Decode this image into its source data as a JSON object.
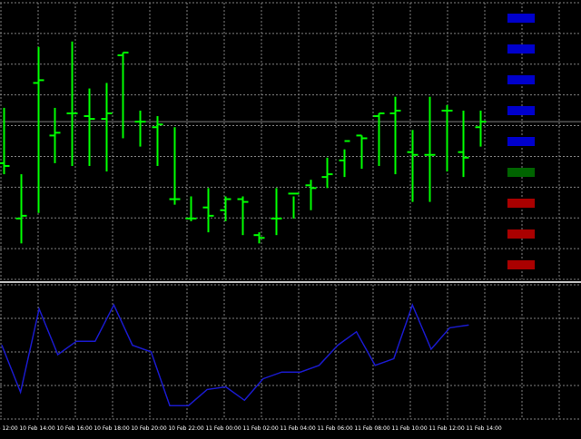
{
  "colors": {
    "background": "#000000",
    "grid": "#808080",
    "bars": "#00ff00",
    "indicator": "#1a1acc",
    "separator": "#c0c0c0",
    "level_blue": "#0000cc",
    "level_green": "#006400",
    "level_red": "#aa0000"
  },
  "chart_data": [
    {
      "type": "ohlc",
      "panel": "price",
      "grid": true,
      "y_range": [
        0,
        100
      ],
      "x_tick_labels": [
        "10 Feb 12:00",
        "10 Feb 14:00",
        "10 Feb 16:00",
        "10 Feb 18:00",
        "10 Feb 20:00",
        "10 Feb 22:00",
        "11 Feb 00:00",
        "11 Feb 02:00",
        "11 Feb 04:00",
        "11 Feb 06:00",
        "11 Feb 08:00",
        "11 Feb 10:00",
        "11 Feb 12:00",
        "11 Feb 14:00"
      ],
      "bars": [
        {
          "o": 42,
          "h": 62,
          "l": 38,
          "c": 41
        },
        {
          "o": 22,
          "h": 38,
          "l": 13,
          "c": 23
        },
        {
          "o": 71,
          "h": 84,
          "l": 24,
          "c": 72
        },
        {
          "o": 52,
          "h": 62,
          "l": 42,
          "c": 53
        },
        {
          "o": 60,
          "h": 86,
          "l": 41,
          "c": 60
        },
        {
          "o": 59,
          "h": 69,
          "l": 41,
          "c": 58
        },
        {
          "o": 58,
          "h": 71,
          "l": 39,
          "c": 60
        },
        {
          "o": 81,
          "h": 82,
          "l": 51,
          "c": 82
        },
        {
          "o": 57,
          "h": 61,
          "l": 48,
          "c": 57
        },
        {
          "o": 55,
          "h": 59,
          "l": 41,
          "c": 56
        },
        {
          "o": 29,
          "h": 55,
          "l": 27,
          "c": 29
        },
        {
          "o": 22,
          "h": 30,
          "l": 21,
          "c": 22
        },
        {
          "o": 26,
          "h": 33,
          "l": 17,
          "c": 23
        },
        {
          "o": 25,
          "h": 30,
          "l": 21,
          "c": 29
        },
        {
          "o": 29,
          "h": 30,
          "l": 16,
          "c": 28
        },
        {
          "o": 16,
          "h": 17,
          "l": 13,
          "c": 15
        },
        {
          "o": 22,
          "h": 33,
          "l": 16,
          "c": 22
        },
        {
          "o": 31,
          "h": 30,
          "l": 22,
          "c": 31
        },
        {
          "o": 34,
          "h": 36,
          "l": 25,
          "c": 33
        },
        {
          "o": 37,
          "h": 44,
          "l": 33,
          "c": 38
        },
        {
          "o": 43,
          "h": 47,
          "l": 37,
          "c": 50
        },
        {
          "o": 52,
          "h": 52,
          "l": 40,
          "c": 51
        },
        {
          "o": 59,
          "h": 60,
          "l": 41,
          "c": 60
        },
        {
          "o": 60,
          "h": 66,
          "l": 38,
          "c": 61
        },
        {
          "o": 46,
          "h": 54,
          "l": 28,
          "c": 45
        },
        {
          "o": 45,
          "h": 66,
          "l": 28,
          "c": 45
        },
        {
          "o": 61,
          "h": 63,
          "l": 39,
          "c": 61
        },
        {
          "o": 46,
          "h": 61,
          "l": 37,
          "c": 44
        },
        {
          "o": 55,
          "h": 61,
          "l": 48,
          "c": 57
        }
      ]
    },
    {
      "type": "line",
      "panel": "indicator",
      "grid": true,
      "y_range": [
        0,
        100
      ],
      "values": [
        55,
        20,
        82,
        48,
        58,
        58,
        85,
        55,
        50,
        10,
        10,
        22,
        24,
        14,
        30,
        35,
        35,
        40,
        55,
        65,
        40,
        45,
        85,
        52,
        68,
        70
      ]
    }
  ]
}
